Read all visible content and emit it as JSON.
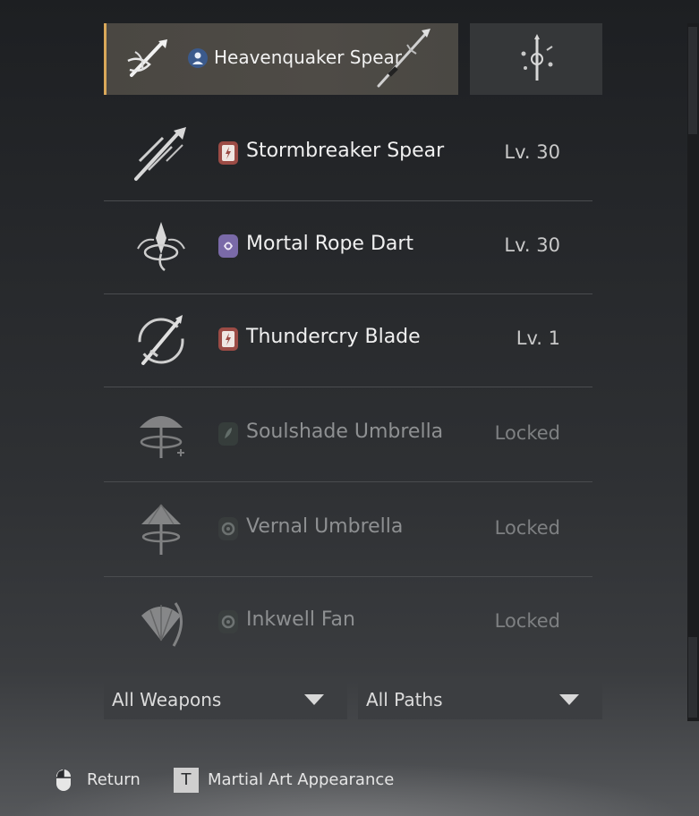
{
  "selected_weapon": {
    "name": "Heavenquaker Spear",
    "emblem_icon": "spear-emblem-icon",
    "path_icon": "bellstrike-path-icon",
    "art_icon": "spear-art-icon"
  },
  "appearance_button": {
    "icon": "weapon-appearance-icon"
  },
  "weapons": [
    {
      "name": "Stormbreaker Spear",
      "level": "Lv. 30",
      "locked": false,
      "emblem_icon": "spear-emblem-icon",
      "path_icon": "lightning-path-icon"
    },
    {
      "name": "Mortal Rope Dart",
      "level": "Lv. 30",
      "locked": false,
      "emblem_icon": "rope-dart-emblem-icon",
      "path_icon": "silkbind-path-icon"
    },
    {
      "name": "Thundercry Blade",
      "level": "Lv. 1",
      "locked": false,
      "emblem_icon": "blade-emblem-icon",
      "path_icon": "lightning-path-icon"
    },
    {
      "name": "Soulshade Umbrella",
      "level": "Locked",
      "locked": true,
      "emblem_icon": "umbrella-emblem-icon",
      "path_icon": "bamboocut-path-icon"
    },
    {
      "name": "Vernal Umbrella",
      "level": "Locked",
      "locked": true,
      "emblem_icon": "umbrella-emblem-icon",
      "path_icon": "swirl-path-icon"
    },
    {
      "name": "Inkwell Fan",
      "level": "Locked",
      "locked": true,
      "emblem_icon": "fan-emblem-icon",
      "path_icon": "swirl-path-icon"
    }
  ],
  "filters": {
    "weapons": "All Weapons",
    "paths": "All Paths"
  },
  "footer": {
    "return_label": "Return",
    "return_icon": "mouse-icon",
    "appearance_key": "T",
    "appearance_label": "Martial Art Appearance"
  },
  "colors": {
    "accent": "#d9a85a",
    "selected_bg": "#4c4944",
    "row_divider": "#4a4c4f",
    "path_red": "#9b4b45",
    "path_purple": "#7a6aa8",
    "path_blue": "#3b5a8c"
  }
}
